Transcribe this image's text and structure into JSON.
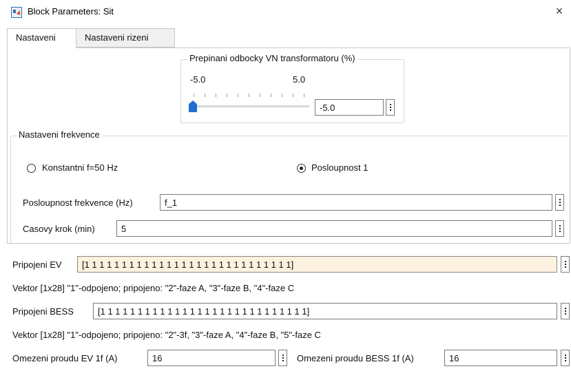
{
  "window": {
    "title": "Block Parameters: Sit",
    "close_glyph": "×"
  },
  "tabs": [
    {
      "label": "Nastaveni",
      "active": true
    },
    {
      "label": "Nastaveni rizeni",
      "active": false
    }
  ],
  "transformer": {
    "legend": "Prepinani odbocky VN transformatoru (%)",
    "min_label": "-5.0",
    "max_label": "5.0",
    "value": "-5.0",
    "slider_fraction": 0.0
  },
  "frequency": {
    "legend": "Nastaveni frekvence",
    "radio_constant": "Konstantni f=50 Hz",
    "radio_sequence": "Posloupnost 1",
    "selected": "sequence",
    "seq_label": "Posloupnost frekvence (Hz)",
    "seq_value": "f_1",
    "step_label": "Casovy krok (min)",
    "step_value": "5"
  },
  "ev": {
    "label": "Pripojeni EV",
    "value": "[1 1 1 1 1 1 1 1 1 1 1 1 1 1 1 1 1 1 1 1 1 1 1 1 1 1 1 1]",
    "note": "Vektor [1x28] \"1\"-odpojeno; pripojeno: \"2\"-faze A, \"3\"-faze B, \"4\"-faze C"
  },
  "bess": {
    "label": "Pripojeni BESS",
    "value": "[1 1 1 1 1 1 1 1 1 1 1 1 1 1 1 1 1 1 1 1 1 1 1 1 1 1 1 1]",
    "note": "Vektor [1x28] \"1\"-odpojeno; pripojeno: \"2\"-3f, \"3\"-faze A, \"4\"-faze B, \"5\"-faze C"
  },
  "limits": {
    "ev_label": "Omezeni proudu EV 1f (A)",
    "ev_value": "16",
    "bess_label": "Omezeni proudu BESS 1f (A)",
    "bess_value": "16"
  },
  "colors": {
    "accent": "#1f6fd1",
    "highlight_field": "#fdf1e0"
  }
}
